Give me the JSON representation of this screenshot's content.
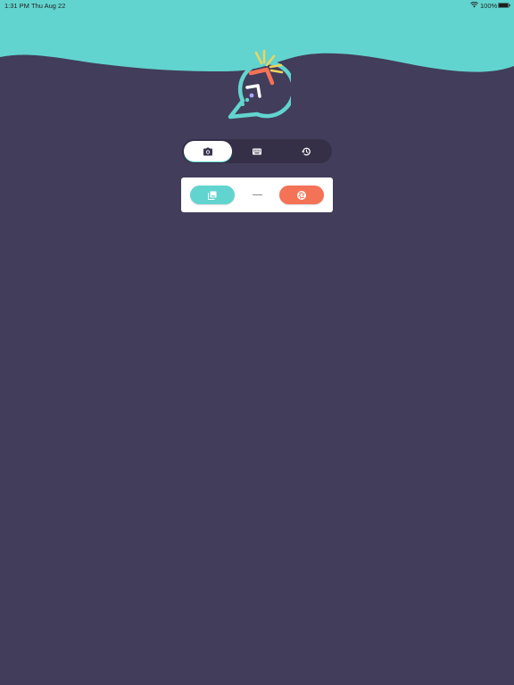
{
  "status_bar": {
    "time": "1:31 PM",
    "date": "Thu Aug 22",
    "battery_text": "100%",
    "wifi_icon": "wifi-icon",
    "battery_icon": "battery-icon"
  },
  "header": {
    "logo_icon": "speech-bubble-logo",
    "wave_color": "#62d4cf"
  },
  "mode_switch": {
    "tabs": [
      {
        "icon": "camera-icon",
        "active": true
      },
      {
        "icon": "keyboard-icon",
        "active": false
      },
      {
        "icon": "history-icon",
        "active": false
      }
    ]
  },
  "capture_card": {
    "gallery_icon": "gallery-icon",
    "capture_icon": "shutter-icon"
  },
  "colors": {
    "background": "#423d5a",
    "switch_bg": "#353048",
    "teal": "#62d4cf",
    "coral": "#f47256",
    "yellow": "#f0d45c"
  }
}
